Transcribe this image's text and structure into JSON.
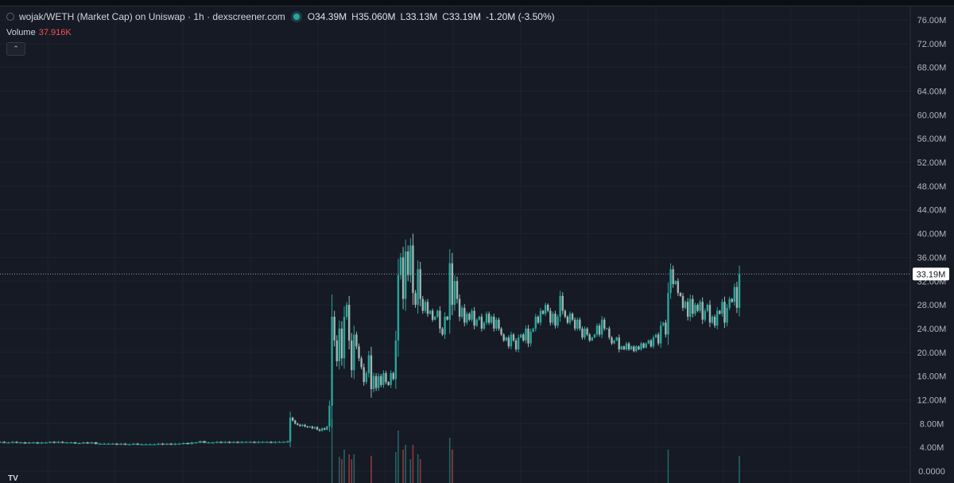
{
  "header": {
    "symbol": "wojak/WETH (Market Cap) on Uniswap · 1h · dexscreener.com",
    "open_label": "O",
    "open": "34.39M",
    "high_label": "H",
    "high": "35.060M",
    "low_label": "L",
    "low": "33.13M",
    "close_label": "C",
    "close": "33.19M",
    "change": "-1.20M (-3.50%)",
    "icon": "pair-logo-icon",
    "live_icon": "live-dot-icon"
  },
  "volume": {
    "label": "Volume",
    "value": "37.916K"
  },
  "collapse_icon": "chevron-up-icon",
  "collapse_glyph": "⌃",
  "logo_text": "TV",
  "colors": {
    "background": "#161a25",
    "grid": "#1f2330",
    "up": "#26a69a",
    "down": "#ef5350",
    "candle": "#9fb7b3",
    "last_price_line": "#9598a1",
    "axis_text": "#b2b5be"
  },
  "chart_data": {
    "type": "candlestick",
    "title": "wojak/WETH (Market Cap) on Uniswap · 1h · dexscreener.com",
    "y_axis": {
      "ticks": [
        "76.00M",
        "72.00M",
        "68.00M",
        "64.00M",
        "60.00M",
        "56.00M",
        "52.00M",
        "48.00M",
        "44.00M",
        "40.00M",
        "36.00M",
        "32.00M",
        "28.00M",
        "24.00M",
        "20.00M",
        "16.00M",
        "12.00M",
        "8.00M",
        "4.00M",
        "0.0000"
      ],
      "range_millions": [
        0,
        76
      ],
      "position": "right"
    },
    "last_price": "33.19M",
    "last_price_millions": 33.19,
    "grid": true,
    "series": [
      {
        "unit": "M",
        "values_millions": [
          4.9,
          4.8,
          4.8,
          4.9,
          4.8,
          4.8,
          4.7,
          4.8,
          4.8,
          4.7,
          4.8,
          4.8,
          4.9,
          4.8,
          4.9,
          4.8,
          4.8,
          4.8,
          4.7,
          4.7,
          4.8,
          4.7,
          4.8,
          4.6,
          4.6,
          4.6,
          4.6,
          4.6,
          4.5,
          4.6,
          4.5,
          4.5,
          4.6,
          4.5,
          4.5,
          4.5,
          4.5,
          4.5,
          4.6,
          4.5,
          4.6,
          4.5,
          4.6,
          4.6,
          4.7,
          4.6,
          4.8,
          4.8,
          5.0,
          4.8,
          4.8,
          4.8,
          4.9,
          4.8,
          4.9,
          4.8,
          4.9,
          4.8,
          4.9,
          4.9,
          4.9,
          4.8,
          4.9,
          4.9,
          4.9,
          4.8,
          4.9,
          4.9,
          4.9,
          5.0,
          9.0,
          8.5,
          8.0,
          7.8,
          7.6,
          7.8,
          7.5,
          7.4,
          7.5,
          7.2,
          7.4,
          7.0,
          6.8,
          7.2,
          7.0,
          7.5,
          11.0,
          26.0,
          22.0,
          18.5,
          24.0,
          19.0,
          26.0,
          28.0,
          22.0,
          17.0,
          23.0,
          21.0,
          19.0,
          17.5,
          15.0,
          16.5,
          19.5,
          13.8,
          16.0,
          14.0,
          16.0,
          14.5,
          16.5,
          15.0,
          14.5,
          16.5,
          15.5,
          22.0,
          33.0,
          36.0,
          29.0,
          37.0,
          33.0,
          38.0,
          30.0,
          28.0,
          34.0,
          29.0,
          27.0,
          28.5,
          26.5,
          27.0,
          25.5,
          26.0,
          27.0,
          24.0,
          23.0,
          26.0,
          25.5,
          35.0,
          28.0,
          32.0,
          29.0,
          26.0,
          27.5,
          25.0,
          26.5,
          25.5,
          27.0,
          24.5,
          25.5,
          26.0,
          24.0,
          25.0,
          26.5,
          25.0,
          26.0,
          24.0,
          25.5,
          24.0,
          23.0,
          22.0,
          22.5,
          21.0,
          23.0,
          22.0,
          20.5,
          22.5,
          23.0,
          22.0,
          24.0,
          21.5,
          23.5,
          24.0,
          26.0,
          25.0,
          27.0,
          26.5,
          28.0,
          27.0,
          25.0,
          26.5,
          24.5,
          26.0,
          29.5,
          27.0,
          26.0,
          25.0,
          26.5,
          25.5,
          24.0,
          25.5,
          24.0,
          22.5,
          24.0,
          23.0,
          22.0,
          22.5,
          23.0,
          24.5,
          23.0,
          25.5,
          24.0,
          24.0,
          22.5,
          21.5,
          22.0,
          22.5,
          20.5,
          21.0,
          20.5,
          21.5,
          20.5,
          21.0,
          20.2,
          21.0,
          20.5,
          21.5,
          20.8,
          21.5,
          22.0,
          21.0,
          22.5,
          23.0,
          21.5,
          24.5,
          25.0,
          23.0,
          30.0,
          34.0,
          31.5,
          32.0,
          30.0,
          29.5,
          27.5,
          28.5,
          26.0,
          29.0,
          26.5,
          28.0,
          27.0,
          28.5,
          25.5,
          27.0,
          28.0,
          25.0,
          26.0,
          24.5,
          27.0,
          26.5,
          28.5,
          25.0,
          27.5,
          29.0,
          28.5,
          31.0,
          27.5,
          33.19
        ]
      }
    ],
    "volume": {
      "unit": "K",
      "visible_spikes": 9
    }
  }
}
